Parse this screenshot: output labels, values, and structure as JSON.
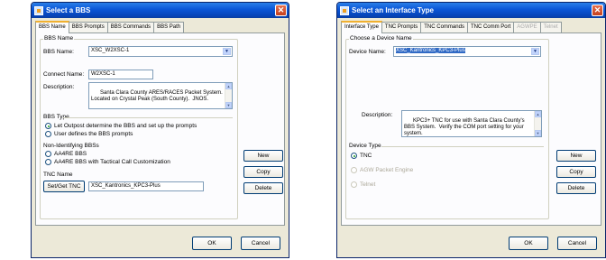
{
  "dialog1": {
    "title": "Select a BBS",
    "tabs": [
      "BBS Name",
      "BBS Prompts",
      "BBS Commands",
      "BBS Path"
    ],
    "active_tab": 0,
    "group_bbs_name": "BBS Name",
    "bbs_name_label": "BBS Name:",
    "bbs_name_value": "XSC_W2XSC-1",
    "connect_name_label": "Connect Name:",
    "connect_name_value": "W2XSC-1",
    "description_label": "Description:",
    "description_value": "Santa Clara County ARES/RACES Packet System.  Located on Crystal Peak (South County).  JNOS.",
    "bbs_type_label": "BBS Type",
    "bbs_type_options": [
      "Let Outpost determine the BBS and set up the prompts",
      "User defines the BBS prompts"
    ],
    "bbs_type_selected": 0,
    "non_identifying_label": "Non-Identifying BBSs",
    "non_identifying_options": [
      "AA4RE BBS",
      "AA4RE BBS with Tactical Call Customization"
    ],
    "tnc_name_label": "TNC Name",
    "set_get_tnc_label": "Set/Get TNC",
    "tnc_name_value": "XSC_Kantronics_KPC3-Plus",
    "new_label": "New",
    "copy_label": "Copy",
    "delete_label": "Delete",
    "ok_label": "OK",
    "cancel_label": "Cancel"
  },
  "dialog2": {
    "title": "Select an Interface Type",
    "tabs": [
      "Interface Type",
      "TNC Prompts",
      "TNC Commands",
      "TNC Comm Port",
      "AGWPE",
      "Telnet"
    ],
    "disabled_tabs": [
      4,
      5
    ],
    "active_tab": 0,
    "group_device_name": "Choose a Device Name",
    "device_name_label": "Device Name:",
    "device_name_value": "XSC_Kantronics_KPC3-Plus",
    "description_label": "Description:",
    "description_value": "KPC3+ TNC for use with Santa Clara County's BBS System.  Verify the COM port setting for your system.",
    "device_type_label": "Device Type",
    "device_type_options": [
      "TNC",
      "AGW Packet Engine",
      "Telnet"
    ],
    "device_type_selected": 0,
    "new_label": "New",
    "copy_label": "Copy",
    "delete_label": "Delete",
    "ok_label": "OK",
    "cancel_label": "Cancel"
  },
  "icons": {
    "close": "close-icon",
    "app": "app-icon",
    "dropdown": "chevron-down-icon"
  },
  "colors": {
    "titlebar": "#0a55d6",
    "dialog_bg": "#ece9d8",
    "close_button": "#d4522f",
    "selection": "#316ac5"
  }
}
